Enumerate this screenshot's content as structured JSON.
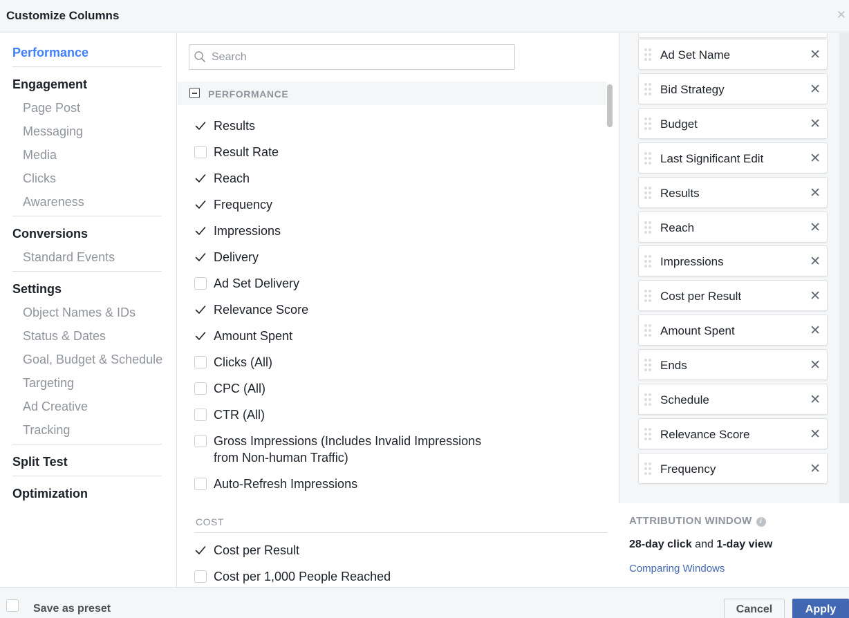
{
  "dialog": {
    "title": "Customize Columns",
    "close_icon": "close-icon"
  },
  "sidebar": {
    "groups": [
      {
        "label": "Performance",
        "active": true,
        "items": []
      },
      {
        "label": "Engagement",
        "active": false,
        "items": [
          "Page Post",
          "Messaging",
          "Media",
          "Clicks",
          "Awareness"
        ]
      },
      {
        "label": "Conversions",
        "active": false,
        "items": [
          "Standard Events"
        ]
      },
      {
        "label": "Settings",
        "active": false,
        "items": [
          "Object Names & IDs",
          "Status & Dates",
          "Goal, Budget & Schedule",
          "Targeting",
          "Ad Creative",
          "Tracking"
        ]
      },
      {
        "label": "Split Test",
        "active": false,
        "items": []
      },
      {
        "label": "Optimization",
        "active": false,
        "items": []
      }
    ]
  },
  "middle": {
    "search": {
      "placeholder": "Search",
      "value": ""
    },
    "section_title": "PERFORMANCE",
    "performance_items": [
      {
        "label": "Results",
        "checked": true
      },
      {
        "label": "Result Rate",
        "checked": false
      },
      {
        "label": "Reach",
        "checked": true
      },
      {
        "label": "Frequency",
        "checked": true
      },
      {
        "label": "Impressions",
        "checked": true
      },
      {
        "label": "Delivery",
        "checked": true
      },
      {
        "label": "Ad Set Delivery",
        "checked": false
      },
      {
        "label": "Relevance Score",
        "checked": true
      },
      {
        "label": "Amount Spent",
        "checked": true
      },
      {
        "label": "Clicks (All)",
        "checked": false
      },
      {
        "label": "CPC (All)",
        "checked": false
      },
      {
        "label": "CTR (All)",
        "checked": false
      },
      {
        "label": "Gross Impressions (Includes Invalid Impressions",
        "label_line2": "from Non-human Traffic)",
        "checked": false
      },
      {
        "label": "Auto-Refresh Impressions",
        "checked": false
      }
    ],
    "cost_section_title": "COST",
    "cost_items": [
      {
        "label": "Cost per Result",
        "checked": true
      },
      {
        "label": "Cost per 1,000 People Reached",
        "checked": false
      }
    ]
  },
  "right": {
    "selected_columns": [
      "Ad Set Name",
      "Bid Strategy",
      "Budget",
      "Last Significant Edit",
      "Results",
      "Reach",
      "Impressions",
      "Cost per Result",
      "Amount Spent",
      "Ends",
      "Schedule",
      "Relevance Score",
      "Frequency"
    ],
    "attribution": {
      "title": "ATTRIBUTION WINDOW",
      "click_value": "28-day click",
      "joiner": " and ",
      "view_value": "1-day view",
      "link": "Comparing Windows"
    }
  },
  "footer": {
    "save_preset_label": "Save as preset",
    "save_preset_checked": false,
    "cancel_label": "Cancel",
    "apply_label": "Apply"
  },
  "colors": {
    "accent": "#4080ff",
    "apply_button": "#4267b2",
    "link": "#4267b2",
    "muted_text": "#90949c"
  }
}
